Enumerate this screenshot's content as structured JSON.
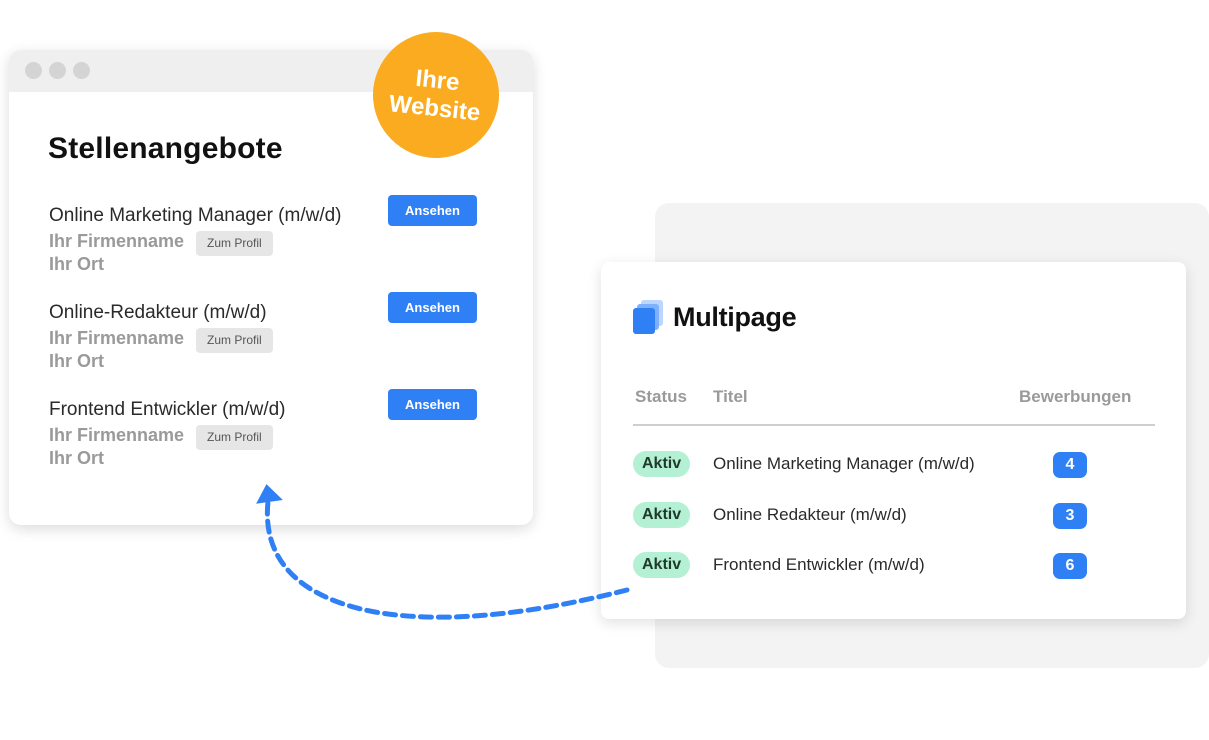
{
  "website": {
    "window_dots": [
      "dot",
      "dot",
      "dot"
    ],
    "title": "Stellenangebote",
    "badge_line1": "Ihre",
    "badge_line2": "Website",
    "jobs": [
      {
        "title": "Online Marketing Manager (m/w/d)",
        "company": "Ihr Firmenname",
        "location": "Ihr Ort",
        "profile_label": "Zum Profil",
        "button_label": "Ansehen"
      },
      {
        "title": "Online-Redakteur (m/w/d)",
        "company": "Ihr Firmenname",
        "location": "Ihr Ort",
        "profile_label": "Zum Profil",
        "button_label": "Ansehen"
      },
      {
        "title": "Frontend Entwickler (m/w/d)",
        "company": "Ihr Firmenname",
        "location": "Ihr Ort",
        "profile_label": "Zum Profil",
        "button_label": "Ansehen"
      }
    ]
  },
  "dashboard": {
    "logo_text": "Multipage",
    "columns": {
      "status": "Status",
      "title": "Titel",
      "applications": "Bewerbungen"
    },
    "rows": [
      {
        "status": "Aktiv",
        "title": "Online Marketing Manager (m/w/d)",
        "applications": "4"
      },
      {
        "status": "Aktiv",
        "title": "Online Redakteur (m/w/d)",
        "applications": "3"
      },
      {
        "status": "Aktiv",
        "title": "Frontend Entwickler (m/w/d)",
        "applications": "6"
      }
    ]
  },
  "colors": {
    "accent_blue": "#2f80f5",
    "badge_orange": "#fbab1f",
    "status_green": "#b4f0d3"
  }
}
